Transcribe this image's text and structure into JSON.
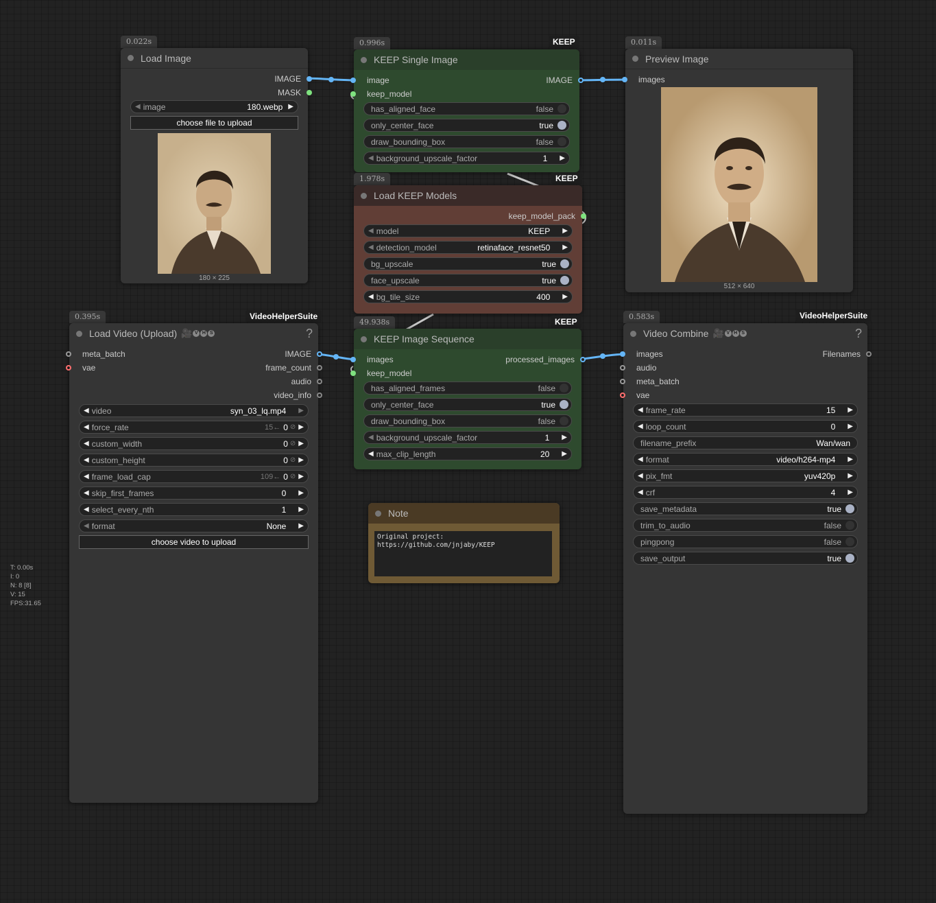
{
  "colors": {
    "keep_green": "#2e4a2e",
    "keep_green_title": "#2a3f2a",
    "keep_brown": "#613e36",
    "keep_brown_title": "#3a2a28",
    "note_gold": "#6f5a35",
    "note_title": "#4a3a24",
    "wire_image": "#64b5f6",
    "wire_model": "#c0c0c0"
  },
  "load_image": {
    "time": "0.022s",
    "title": "Load Image",
    "outputs": [
      "IMAGE",
      "MASK"
    ],
    "image_widget": {
      "label": "image",
      "value": "180.webp"
    },
    "upload_button": "choose file to upload",
    "caption": "180 × 225"
  },
  "keep_single": {
    "time": "0.996s",
    "tag": "KEEP",
    "title": "KEEP Single Image",
    "inputs": [
      "image",
      "keep_model"
    ],
    "output": "IMAGE",
    "widgets": [
      {
        "label": "has_aligned_face",
        "value": "false"
      },
      {
        "label": "only_center_face",
        "value": "true"
      },
      {
        "label": "draw_bounding_box",
        "value": "false"
      },
      {
        "label": "background_upscale_factor",
        "value": "1"
      }
    ]
  },
  "load_models": {
    "time": "1.978s",
    "tag": "KEEP",
    "title": "Load KEEP Models",
    "output": "keep_model_pack",
    "widgets": [
      {
        "label": "model",
        "value": "KEEP"
      },
      {
        "label": "detection_model",
        "value": "retinaface_resnet50"
      },
      {
        "label": "bg_upscale",
        "value": "true"
      },
      {
        "label": "face_upscale",
        "value": "true"
      },
      {
        "label": "bg_tile_size",
        "value": "400"
      }
    ]
  },
  "preview": {
    "time": "0.011s",
    "title": "Preview Image",
    "input": "images",
    "caption": "512 × 640"
  },
  "load_video": {
    "time": "0.395s",
    "tag": "VideoHelperSuite",
    "title": "Load Video (Upload)",
    "help": "?",
    "inputs": [
      "meta_batch",
      "vae"
    ],
    "outputs": [
      "IMAGE",
      "frame_count",
      "audio",
      "video_info"
    ],
    "widgets": [
      {
        "label": "video",
        "value": "syn_03_lq.mp4"
      },
      {
        "label": "force_rate",
        "ghost": "15←",
        "value": "0"
      },
      {
        "label": "custom_width",
        "value": "0"
      },
      {
        "label": "custom_height",
        "value": "0"
      },
      {
        "label": "frame_load_cap",
        "ghost": "109←",
        "value": "0"
      },
      {
        "label": "skip_first_frames",
        "value": "0"
      },
      {
        "label": "select_every_nth",
        "value": "1"
      },
      {
        "label": "format",
        "value": "None"
      }
    ],
    "upload_button": "choose video to upload"
  },
  "keep_seq": {
    "time": "49.938s",
    "tag": "KEEP",
    "title": "KEEP Image Sequence",
    "inputs": [
      "images",
      "keep_model"
    ],
    "output": "processed_images",
    "widgets": [
      {
        "label": "has_aligned_frames",
        "value": "false"
      },
      {
        "label": "only_center_face",
        "value": "true"
      },
      {
        "label": "draw_bounding_box",
        "value": "false"
      },
      {
        "label": "background_upscale_factor",
        "value": "1"
      },
      {
        "label": "max_clip_length",
        "value": "20"
      }
    ]
  },
  "video_combine": {
    "time": "0.583s",
    "tag": "VideoHelperSuite",
    "title": "Video Combine",
    "help": "?",
    "inputs": [
      "images",
      "audio",
      "meta_batch",
      "vae"
    ],
    "output": "Filenames",
    "widgets": [
      {
        "label": "frame_rate",
        "value": "15"
      },
      {
        "label": "loop_count",
        "value": "0"
      },
      {
        "label": "filename_prefix",
        "value": "Wan/wan"
      },
      {
        "label": "format",
        "value": "video/h264-mp4"
      },
      {
        "label": "pix_fmt",
        "value": "yuv420p"
      },
      {
        "label": "crf",
        "value": "4"
      },
      {
        "label": "save_metadata",
        "value": "true"
      },
      {
        "label": "trim_to_audio",
        "value": "false"
      },
      {
        "label": "pingpong",
        "value": "false"
      },
      {
        "label": "save_output",
        "value": "true"
      }
    ]
  },
  "note": {
    "title": "Note",
    "text": "Original project:\nhttps://github.com/jnjaby/KEEP"
  },
  "stats": [
    "T: 0.00s",
    "I: 0",
    "N: 8 [8]",
    "V: 15",
    "FPS:31.65"
  ]
}
